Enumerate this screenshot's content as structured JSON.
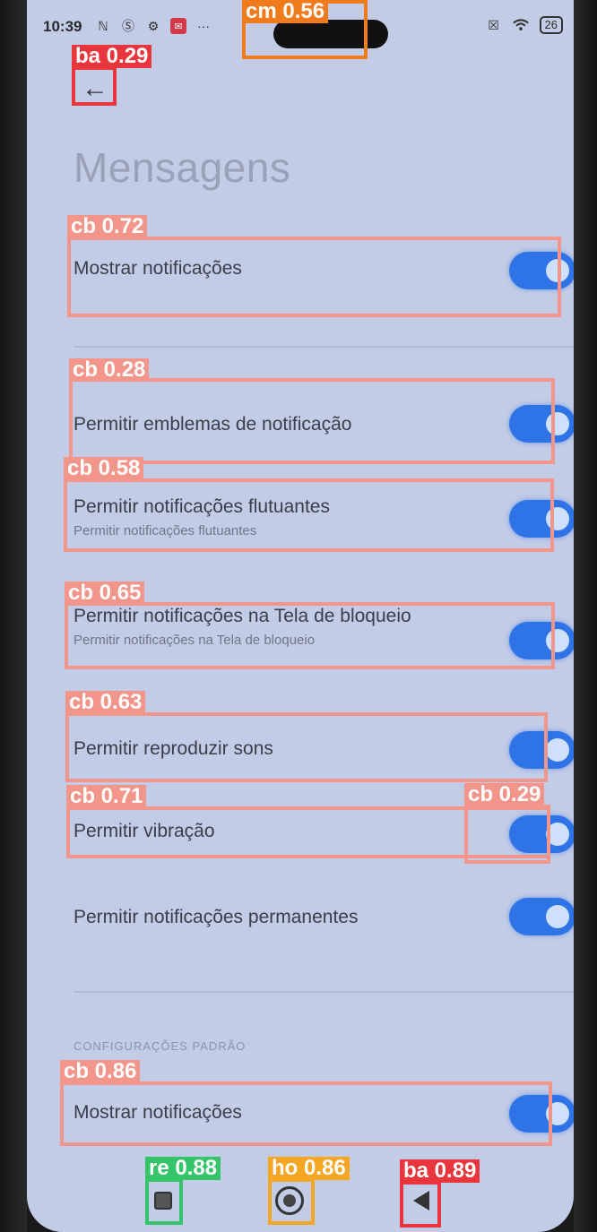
{
  "status_bar": {
    "time": "10:39",
    "icons_left": [
      "nfc-icon",
      "s-icon",
      "gear-icon",
      "mail-icon"
    ],
    "dots": "···",
    "battery": "26"
  },
  "header": {
    "title": "Mensagens"
  },
  "settings": [
    {
      "label": "Mostrar notificações",
      "sub": "",
      "on": true
    },
    {
      "label": "Permitir emblemas de notificação",
      "sub": "",
      "on": true
    },
    {
      "label": "Permitir notificações flutuantes",
      "sub": "Permitir notificações flutuantes",
      "on": true
    },
    {
      "label": "Permitir notificações na Tela de bloqueio",
      "sub": "Permitir notificações na Tela de bloqueio",
      "on": true
    },
    {
      "label": "Permitir reproduzir sons",
      "sub": "",
      "on": true
    },
    {
      "label": "Permitir vibração",
      "sub": "",
      "on": true
    },
    {
      "label": "Permitir notificações permanentes",
      "sub": "",
      "on": true
    },
    {
      "label": "Mostrar notificações",
      "sub": "",
      "on": true
    }
  ],
  "section_header": "CONFIGURAÇÕES PADRÃO",
  "navbar": {
    "icons": [
      "recent-apps-icon",
      "home-icon",
      "back-icon"
    ]
  },
  "detections": [
    {
      "label": "cm 0.56",
      "color": "#f07b1c"
    },
    {
      "label": "ba 0.29",
      "color": "#e8363c"
    },
    {
      "label": "cb 0.72",
      "color": "#f2958a"
    },
    {
      "label": "cb 0.28",
      "color": "#f2958a"
    },
    {
      "label": "cb 0.58",
      "color": "#f2958a"
    },
    {
      "label": "cb 0.65",
      "color": "#f2958a"
    },
    {
      "label": "cb 0.63",
      "color": "#f2958a"
    },
    {
      "label": "cb 0.71",
      "color": "#f2958a"
    },
    {
      "label": "cb 0.29",
      "color": "#f2958a"
    },
    {
      "label": "cb 0.86",
      "color": "#f2958a"
    },
    {
      "label": "re 0.88",
      "color": "#36c46a"
    },
    {
      "label": "ho 0.86",
      "color": "#f5a623"
    },
    {
      "label": "ba 0.89",
      "color": "#e8363c"
    }
  ]
}
